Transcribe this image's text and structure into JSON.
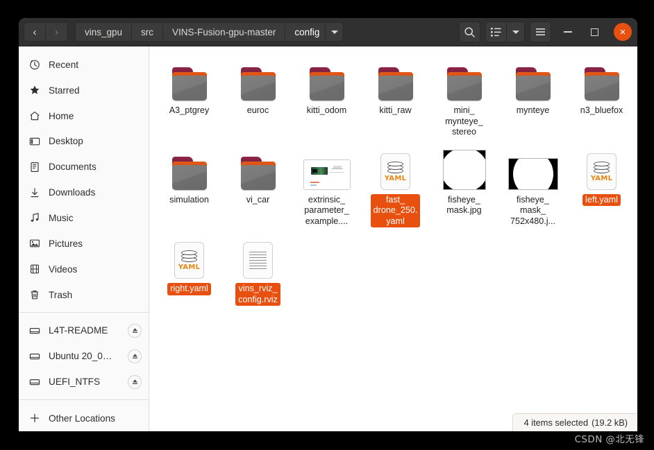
{
  "header": {
    "nav": {
      "back_label": "‹",
      "forward_label": "›"
    },
    "breadcrumbs": [
      {
        "label": "vins_gpu"
      },
      {
        "label": "src"
      },
      {
        "label": "VINS-Fusion-gpu-master"
      },
      {
        "label": "config"
      }
    ],
    "buttons": {
      "search": "search-icon",
      "view_list": "list-view-icon",
      "view_dropdown": "chevron-down-icon",
      "menu": "hamburger-menu-icon",
      "minimize": "minimize-icon",
      "maximize": "maximize-icon",
      "close": "×"
    }
  },
  "sidebar": {
    "places": [
      {
        "label": "Recent",
        "icon": "clock-icon"
      },
      {
        "label": "Starred",
        "icon": "star-icon"
      },
      {
        "label": "Home",
        "icon": "home-icon"
      },
      {
        "label": "Desktop",
        "icon": "desktop-icon"
      },
      {
        "label": "Documents",
        "icon": "document-icon"
      },
      {
        "label": "Downloads",
        "icon": "download-icon"
      },
      {
        "label": "Music",
        "icon": "music-note-icon"
      },
      {
        "label": "Pictures",
        "icon": "picture-icon"
      },
      {
        "label": "Videos",
        "icon": "video-icon"
      },
      {
        "label": "Trash",
        "icon": "trash-icon"
      }
    ],
    "devices": [
      {
        "label": "L4T-README",
        "icon": "drive-icon",
        "eject": "eject-icon"
      },
      {
        "label": "Ubuntu 20_0…",
        "icon": "drive-icon",
        "eject": "eject-icon"
      },
      {
        "label": "UEFI_NTFS",
        "icon": "drive-icon",
        "eject": "eject-icon"
      }
    ],
    "other": {
      "label": "Other Locations",
      "icon": "plus-icon"
    }
  },
  "files": [
    {
      "name": "A3_ptgrey",
      "type": "folder",
      "selected": false
    },
    {
      "name": "euroc",
      "type": "folder",
      "selected": false
    },
    {
      "name": "kitti_odom",
      "type": "folder",
      "selected": false
    },
    {
      "name": "kitti_raw",
      "type": "folder",
      "selected": false
    },
    {
      "name": "mini_\nmynteye_\nstereo",
      "type": "folder",
      "selected": false
    },
    {
      "name": "mynteye",
      "type": "folder",
      "selected": false
    },
    {
      "name": "n3_bluefox",
      "type": "folder",
      "selected": false
    },
    {
      "name": "simulation",
      "type": "folder",
      "selected": false
    },
    {
      "name": "vi_car",
      "type": "folder",
      "selected": false
    },
    {
      "name": "extrinsic_\nparameter_\nexample....",
      "type": "doc-image",
      "selected": false
    },
    {
      "name": "fast_\ndrone_250.\nyaml",
      "type": "yaml",
      "selected": true
    },
    {
      "name": "fisheye_\nmask.jpg",
      "type": "mask-square",
      "selected": false
    },
    {
      "name": "fisheye_\nmask_\n752x480.j...",
      "type": "mask-wide",
      "selected": false
    },
    {
      "name": "left.yaml",
      "type": "yaml",
      "selected": true
    },
    {
      "name": "right.yaml",
      "type": "yaml",
      "selected": true
    },
    {
      "name": "vins_rviz_\nconfig.rviz",
      "type": "text",
      "selected": true
    }
  ],
  "statusbar": {
    "selection_text": "4 items selected",
    "size_text": "(19.2 kB)"
  },
  "watermark": {
    "text": "CSDN @北无锋"
  },
  "colors": {
    "accent_orange": "#e8500f",
    "headerbar": "#303030",
    "sidebar_bg": "#fafafa",
    "folder_tab": "#8e2448",
    "folder_strip": "#d9500f",
    "yaml_word": "#e8860f"
  }
}
